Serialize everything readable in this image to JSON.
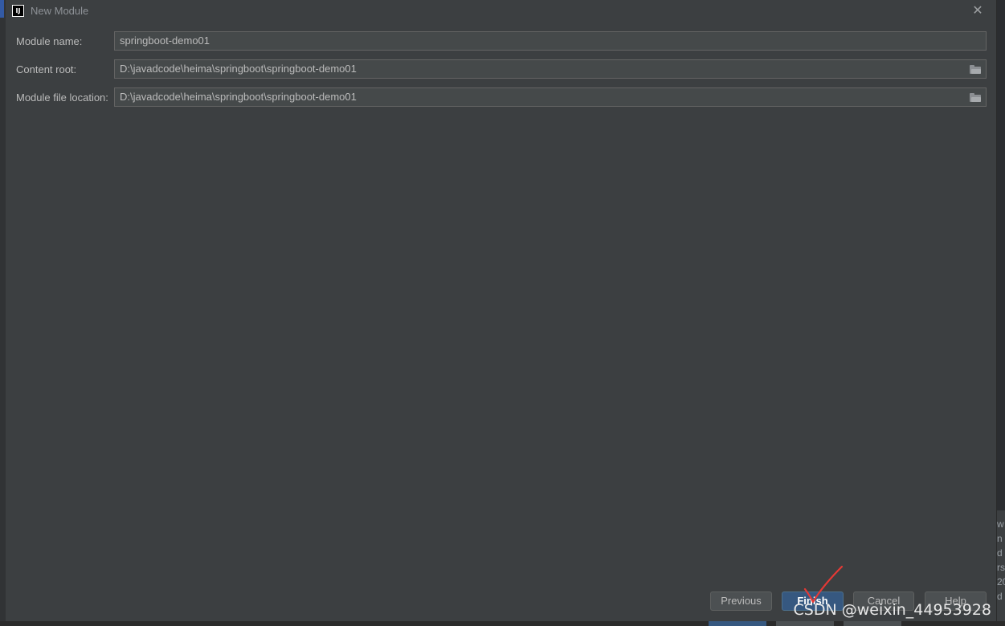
{
  "dialog": {
    "title": "New Module",
    "logo_text": "IJ",
    "close_glyph": "✕"
  },
  "form": {
    "module_name": {
      "label": "Module name:",
      "value": "springboot-demo01"
    },
    "content_root": {
      "label": "Content root:",
      "value": "D:\\javadcode\\heima\\springboot\\springboot-demo01"
    },
    "module_file_location": {
      "label": "Module file location:",
      "value": "D:\\javadcode\\heima\\springboot\\springboot-demo01"
    }
  },
  "buttons": {
    "previous": "Previous",
    "finish": "Finish",
    "cancel": "Cancel",
    "help": "Help"
  },
  "background": {
    "right_strip_text": "w\nn\nd\nrs\n20\nd"
  },
  "watermark": {
    "text": "CSDN @weixin_44953928"
  },
  "colors": {
    "dialog_bg": "#3c3f41",
    "field_bg": "#45494a",
    "primary_button": "#365880",
    "annotation": "#e53935"
  },
  "icons": {
    "app_logo": "intellij-logo-icon",
    "close": "close-icon",
    "browse": "folder-icon",
    "annotation": "red-checkmark"
  }
}
